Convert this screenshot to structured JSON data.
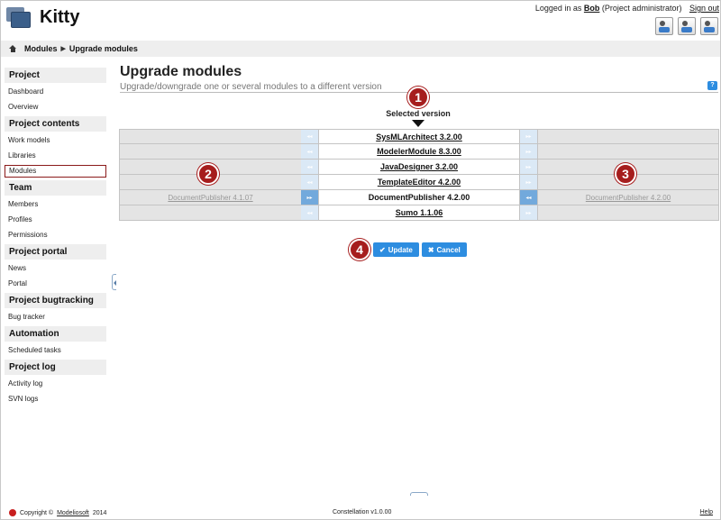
{
  "app": {
    "title": "Kitty"
  },
  "header": {
    "logged_in_prefix": "Logged in as",
    "user": "Bob",
    "role": "(Project administrator)",
    "sign_out": "Sign out"
  },
  "breadcrumb": {
    "items": [
      "Modules",
      "Upgrade modules"
    ]
  },
  "sidebar": {
    "sections": [
      {
        "title": "Project",
        "items": [
          "Dashboard",
          "Overview"
        ]
      },
      {
        "title": "Project contents",
        "items": [
          "Work models",
          "Libraries",
          "Modules"
        ]
      },
      {
        "title": "Team",
        "items": [
          "Members",
          "Profiles",
          "Permissions"
        ]
      },
      {
        "title": "Project portal",
        "items": [
          "News",
          "Portal"
        ]
      },
      {
        "title": "Project bugtracking",
        "items": [
          "Bug tracker"
        ]
      },
      {
        "title": "Automation",
        "items": [
          "Scheduled tasks"
        ]
      },
      {
        "title": "Project log",
        "items": [
          "Activity log",
          "SVN logs"
        ]
      }
    ],
    "active_item": "Modules"
  },
  "main": {
    "title": "Upgrade modules",
    "subtitle": "Upgrade/downgrade one or several modules to a different version",
    "help": "?",
    "selected_version_label": "Selected version",
    "rows": [
      {
        "left": "",
        "selected": "SysMLArchitect 3.2.00",
        "right": ""
      },
      {
        "left": "",
        "selected": "ModelerModule 8.3.00",
        "right": ""
      },
      {
        "left": "",
        "selected": "JavaDesigner 3.2.00",
        "right": ""
      },
      {
        "left": "",
        "selected": "TemplateEditor 4.2.00",
        "right": ""
      },
      {
        "left": "DocumentPublisher 4.1.07",
        "selected": "DocumentPublisher 4.2.00",
        "right": "DocumentPublisher 4.2.00"
      },
      {
        "left": "",
        "selected": "Sumo 1.1.06",
        "right": ""
      }
    ],
    "badges": [
      "1",
      "2",
      "3",
      "4"
    ],
    "update_label": "Update",
    "cancel_label": "Cancel"
  },
  "footer": {
    "copyright_prefix": "Copyright ©",
    "copyright_link": "Modeliosoft",
    "copyright_year": "2014",
    "version": "Constellation v1.0.00",
    "help": "Help"
  },
  "colors": {
    "accent": "#2d8de0",
    "badge": "#a61d1d",
    "active_border": "#8b1a1a"
  }
}
